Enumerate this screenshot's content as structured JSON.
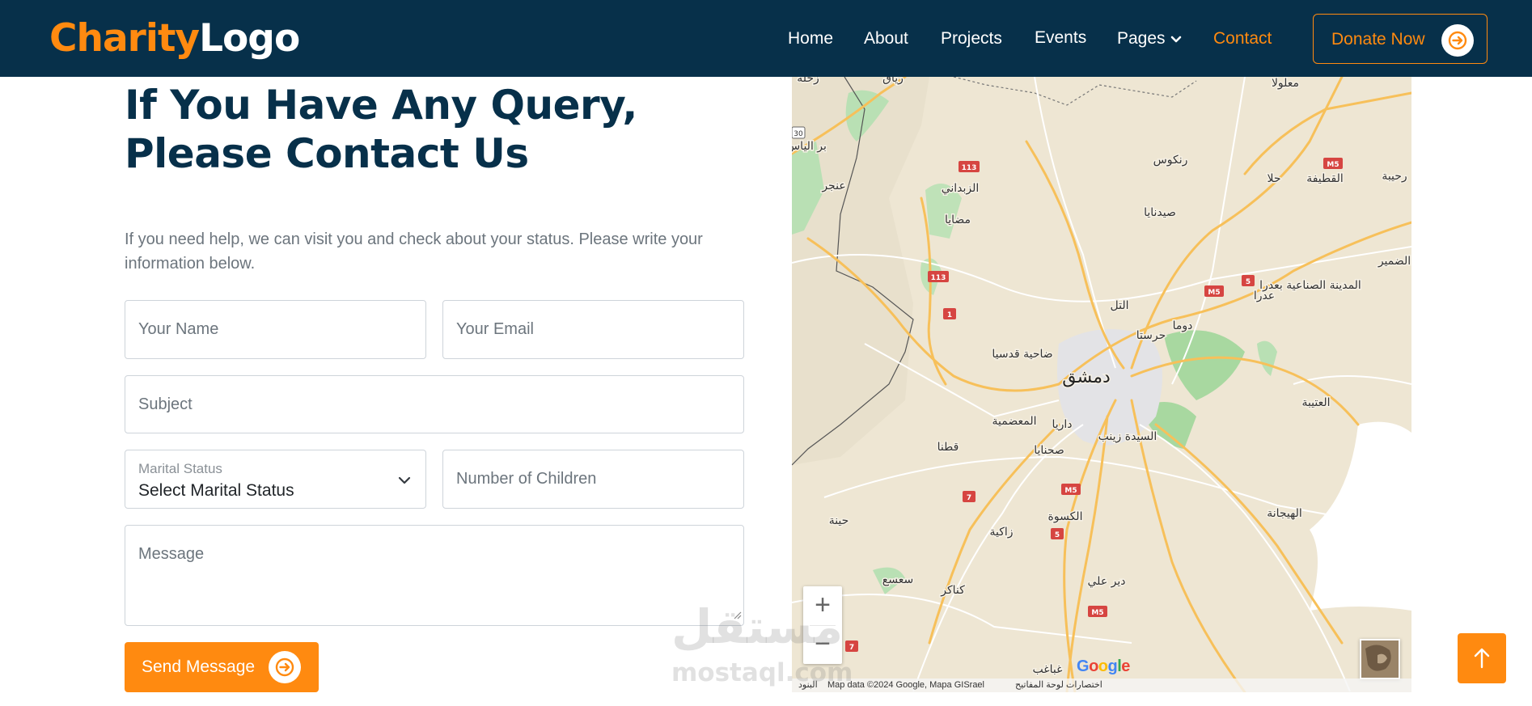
{
  "brand": {
    "logo_part1": "Charity",
    "logo_part2": "Logo",
    "accent": "#ff8a10",
    "navy": "#07304a"
  },
  "nav": {
    "items": [
      {
        "label": "Home"
      },
      {
        "label": "About"
      },
      {
        "label": "Projects"
      },
      {
        "label": "Events"
      },
      {
        "label": "Pages"
      },
      {
        "label": "Contact"
      }
    ],
    "active": "Contact",
    "donate_label": "Donate Now"
  },
  "contact": {
    "heading": "If You Have Any Query, Please Contact Us",
    "description": "If you need help, we can visit you and check about your status. Please write your information below.",
    "name_placeholder": "Your Name",
    "email_placeholder": "Your Email",
    "subject_placeholder": "Subject",
    "marital_label": "Marital Status",
    "marital_value": "Select Marital Status",
    "children_placeholder": "Number of Children",
    "message_placeholder": "Message",
    "send_label": "Send Message"
  },
  "map": {
    "city_main": "دمشق",
    "places": [
      "زحلة",
      "رياق",
      "معلولا",
      "بر الياس",
      "الزبداني",
      "رنكوس",
      "حلا",
      "القطيفة",
      "رحيبة",
      "عنجر",
      "مضايا",
      "صيدنايا",
      "الضمير",
      "التل",
      "عدرا",
      "المدينة الصناعية بعدرا",
      "دوما",
      "حرستا",
      "ضاحية قدسيا",
      "المعضمية",
      "داريا",
      "العتيبة",
      "قطنا",
      "صحنايا",
      "السيدة زينب",
      "الكسوة",
      "الهيجانة",
      "حينة",
      "زاكية",
      "سعسع",
      "كناكر",
      "دير علي",
      "غباغب"
    ],
    "road_labels": [
      "113",
      "113",
      "M5",
      "M5",
      "5",
      "1",
      "7",
      "M5",
      "5",
      "M5",
      "7",
      "30"
    ],
    "zoom_in": "+",
    "zoom_out": "−",
    "google_text": "Google",
    "attribution": "Map data ©2024 Google, Mapa GISrael",
    "shortcuts": "اختصارات لوحة المفاتيح",
    "terms": "البنود"
  },
  "watermark": {
    "line1": "مستقل",
    "line2": "mostaql.com"
  }
}
